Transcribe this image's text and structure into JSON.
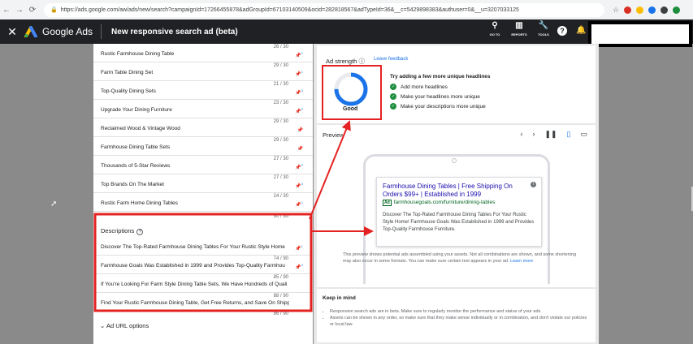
{
  "browser": {
    "url": "https://ads.google.com/aw/ads/new/search?campaignId=17266455878&adGroupId=67103140509&ocid=282818567&adTypeId=36&__c=5429898383&authuser=0&__u=3207033125",
    "icons": [
      "back-icon",
      "forward-icon",
      "reload-icon",
      "lock-icon",
      "star-icon",
      "extension-icons"
    ]
  },
  "app": {
    "name": "Google Ads",
    "page_title": "New responsive search ad (beta)"
  },
  "toolbar": {
    "go_to": "GO TO",
    "reports": "REPORTS",
    "tools": "TOOLS"
  },
  "headlines": [
    {
      "text": "Rustic Farmhouse Dining Table",
      "count": "26 / 30",
      "pin": "1"
    },
    {
      "text": "Farm Table Dining Set",
      "count": "29 / 30",
      "pin": "1"
    },
    {
      "text": "Top-Quality Dining Sets",
      "count": "21 / 30",
      "pin": "3"
    },
    {
      "text": "Upgrade Your Dining Furniture",
      "count": "23 / 30",
      "pin": "2"
    },
    {
      "text": "Reclaimed Wood & Vintage Wood",
      "count": "29 / 30",
      "pin": ""
    },
    {
      "text": "Farmhouse Dining Table Sets",
      "count": "29 / 30",
      "pin": ""
    },
    {
      "text": "Thousands of 5-Star Reviews",
      "count": "27 / 30",
      "pin": "2"
    },
    {
      "text": "Top Brands On The Market",
      "count": "27 / 30",
      "pin": "3"
    },
    {
      "text": "Rustic Farm Home Dining Tables",
      "count": "24 / 30",
      "pin": "1"
    }
  ],
  "last_headline_count": "30 / 30",
  "descriptions": {
    "title": "Descriptions",
    "items": [
      {
        "text": "Discover The Top-Rated Farmhouse Dining Tables For Your Rustic Style Home",
        "count": "74 / 90",
        "pin": "1"
      },
      {
        "text": "Farmhouse Goals Was Established in 1999 and Provides Top-Quality Farmhou",
        "count": "85 / 90",
        "pin": "2"
      },
      {
        "text": "If You're Looking For Farm Style Dining Table Sets, We Have Hundreds of Quali",
        "count": "88 / 90",
        "pin": ""
      },
      {
        "text": "Find Your Rustic Farmhouse Dining Table, Get Free Returns, and Save On Shipp",
        "count": "86 / 90",
        "pin": ""
      }
    ]
  },
  "ad_url_options": "Ad URL options",
  "ad_strength": {
    "label": "Ad strength",
    "link": "Leave feedback",
    "rating": "Good",
    "level": 0.75,
    "heading": "Try adding a few more unique headlines",
    "tips": [
      "Add more headlines",
      "Make your headlines more unique",
      "Make your descriptions more unique"
    ]
  },
  "preview": {
    "title": "Preview",
    "ad": {
      "headline": "Farmhouse Dining Tables | Free Shipping On Orders $99+ | Established in 1999",
      "tag": "Ad",
      "display_url": "farmhousegoals.com/furniture/dining-tables",
      "description": "Discover The Top-Rated Farmhouse Dining Tables For Your Rustic Style Home! Farmhouse Goals Was Established in 1999 and Provides Top-Quality Farmhouse Furniture."
    },
    "note": "This preview shows potential ads assembled using your assets. Not all combinations are shown, and some shortening may also occur in some formats. You can make sure certain text appears in your ad.",
    "learn_more": "Learn more"
  },
  "keep_in_mind": {
    "title": "Keep in mind",
    "items": [
      "Responsive search ads are in beta. Make sure to regularly monitor the performance and status of your ads.",
      "Assets can be shown in any order, so make sure that they make sense individually or in combination, and don't violate our policies or local law."
    ]
  },
  "colors": {
    "annotation": "#e52222",
    "accent": "#1a73e8",
    "appbar": "#202124"
  }
}
